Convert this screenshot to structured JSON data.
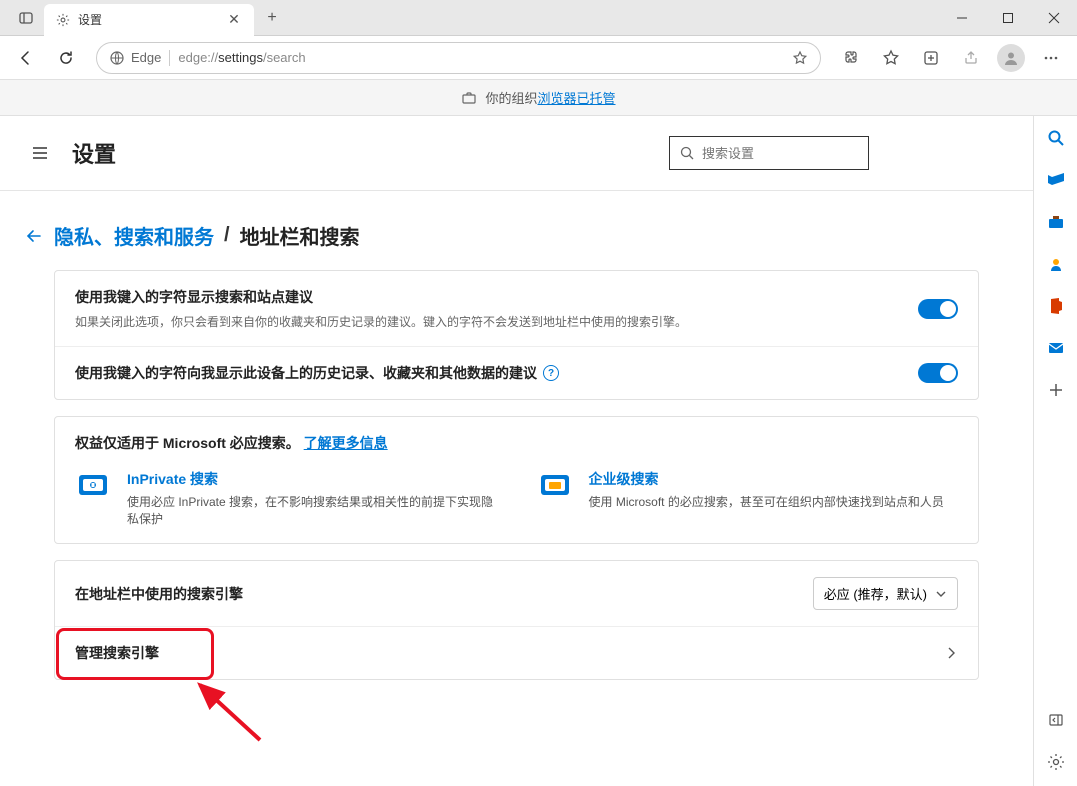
{
  "tab": {
    "title": "设置"
  },
  "address": {
    "prefix": "Edge",
    "url_prefix": "edge://",
    "url_bold": "settings",
    "url_suffix": "/search"
  },
  "banner": {
    "text": "你的组织",
    "link": "浏览器已托管"
  },
  "header": {
    "title": "设置",
    "search_placeholder": "搜索设置"
  },
  "breadcrumb": {
    "link": "隐私、搜索和服务",
    "sep": "/",
    "current": "地址栏和搜索"
  },
  "settings": {
    "row1": {
      "title": "使用我键入的字符显示搜索和站点建议",
      "desc": "如果关闭此选项，你只会看到来自你的收藏夹和历史记录的建议。键入的字符不会发送到地址栏中使用的搜索引擎。"
    },
    "row2": {
      "title": "使用我键入的字符向我显示此设备上的历史记录、收藏夹和其他数据的建议"
    }
  },
  "benefits": {
    "title_prefix": "权益仅适用于 Microsoft 必应搜索。",
    "title_link": "了解更多信息",
    "item1": {
      "name": "InPrivate 搜索",
      "desc": "使用必应 InPrivate 搜索，在不影响搜索结果或相关性的前提下实现隐私保护"
    },
    "item2": {
      "name": "企业级搜索",
      "desc": "使用 Microsoft 的必应搜索，甚至可在组织内部快速找到站点和人员"
    }
  },
  "engine": {
    "label": "在地址栏中使用的搜索引擎",
    "selected": "必应 (推荐，默认)"
  },
  "manage": {
    "label": "管理搜索引擎"
  }
}
